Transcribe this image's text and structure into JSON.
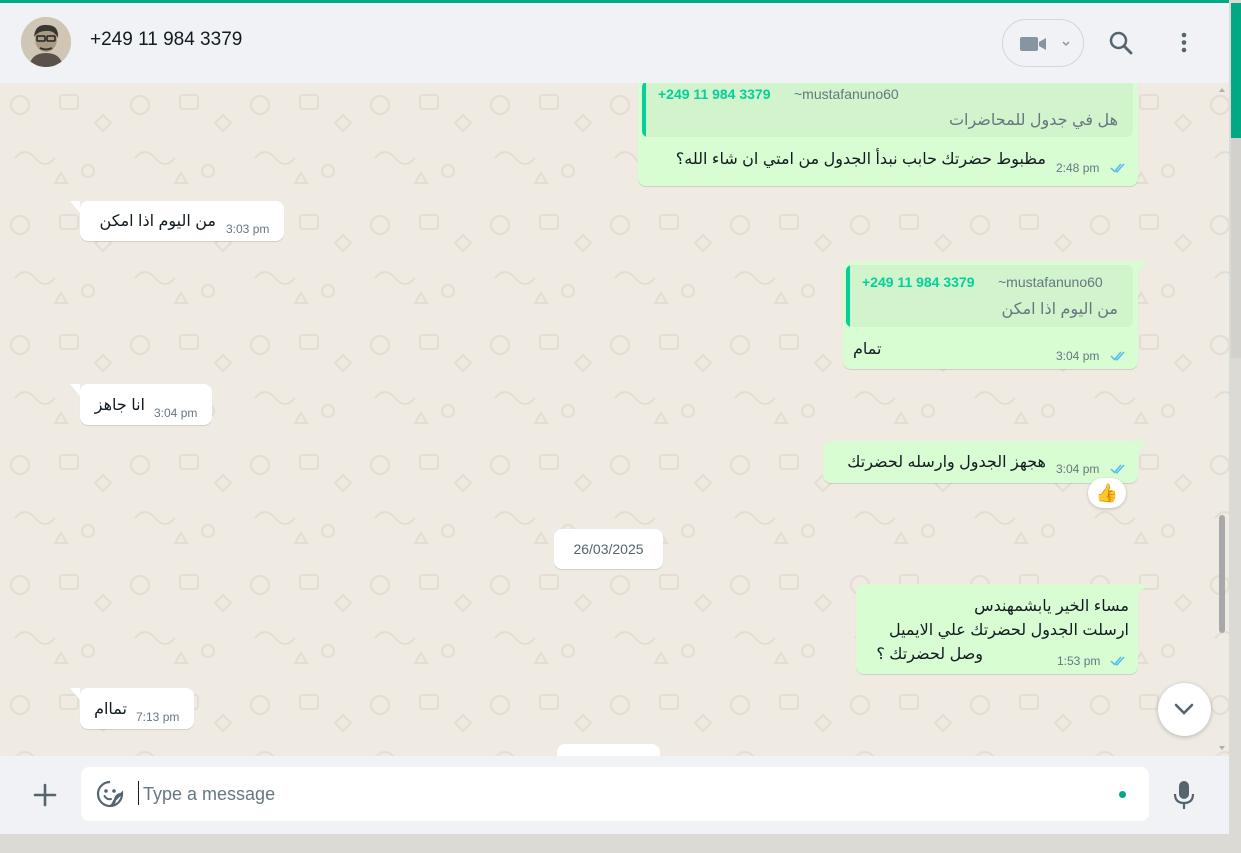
{
  "colors": {
    "accent": "#00a884",
    "outgoing_bubble": "#d9fdd3",
    "incoming_bubble": "#ffffff",
    "quote_author": "#06cf9c",
    "read_ticks": "#53bdeb",
    "chat_background": "#efeae2"
  },
  "header": {
    "contact_name": "+249 11 984 3379",
    "icons": [
      "avatar",
      "video-call-icon",
      "chevron-down-icon",
      "search-icon",
      "menu-icon"
    ]
  },
  "messages": [
    {
      "direction": "outgoing",
      "quote": {
        "author": "+249 11 984 3379",
        "handle": "~mustafanuno60",
        "text": "هل في جدول للمحاضرات"
      },
      "text": "مظبوط حضرتك حابب نبدأ الجدول من امتي ان شاء الله؟",
      "time": "2:48 pm",
      "status": "read"
    },
    {
      "direction": "incoming",
      "text": "من اليوم اذا امكن",
      "time": "3:03 pm"
    },
    {
      "direction": "outgoing",
      "quote": {
        "author": "+249 11 984 3379",
        "handle": "~mustafanuno60",
        "text": "من اليوم اذا امكن"
      },
      "text": "تمام",
      "time": "3:04 pm",
      "status": "read"
    },
    {
      "direction": "incoming",
      "text": "انا جاهز",
      "time": "3:04 pm"
    },
    {
      "direction": "outgoing",
      "text": "هجهز الجدول وارسله لحضرتك",
      "time": "3:04 pm",
      "status": "read",
      "reaction": "👍"
    },
    {
      "direction": "outgoing",
      "lines": [
        "مساء الخير يابشمهندس",
        "ارسلت الجدول لحضرتك علي الايميل",
        "وصل لحضرتك ؟"
      ],
      "time": "1:53 pm",
      "status": "read"
    },
    {
      "direction": "incoming",
      "text": "تماام",
      "time": "7:13 pm"
    }
  ],
  "date_separator": "26/03/2025",
  "composer": {
    "placeholder": "Type a message",
    "icons": [
      "plus-icon",
      "sticker-icon",
      "mic-icon"
    ]
  }
}
